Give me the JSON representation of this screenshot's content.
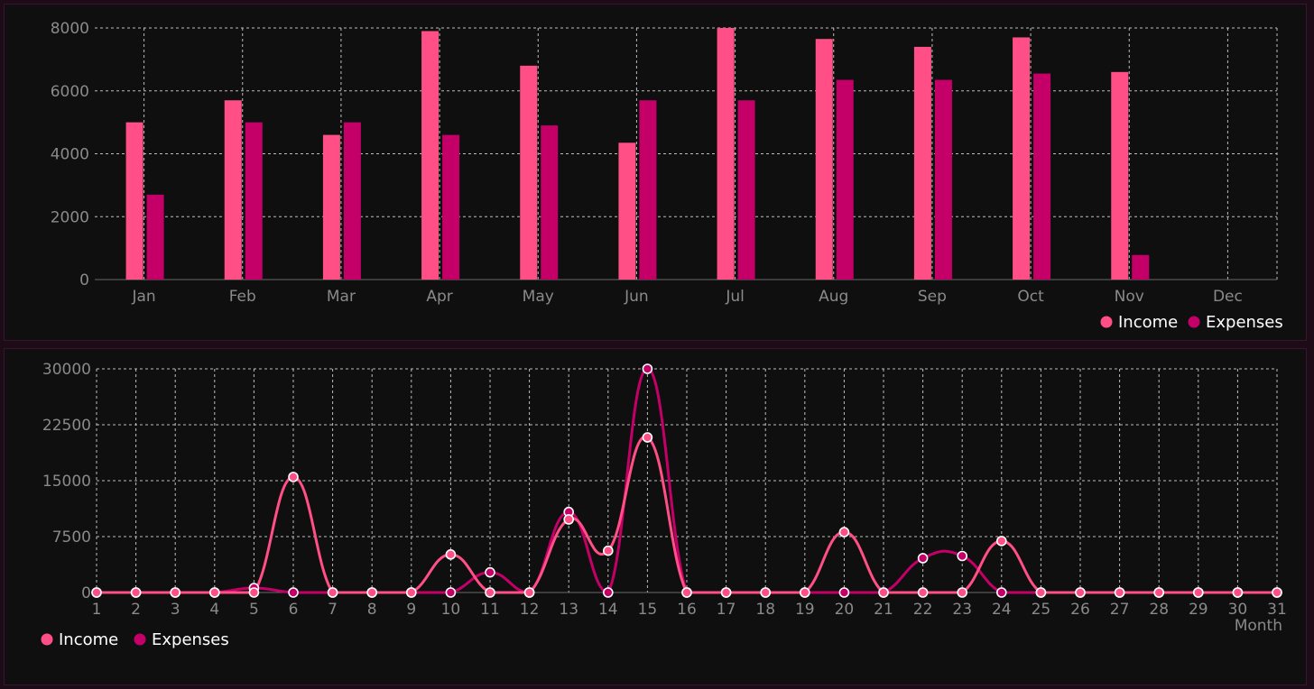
{
  "colors": {
    "income": "#ff4f86",
    "expenses": "#c40068",
    "background": "#0f0f0f",
    "grid": "#bdbdbd",
    "tick": "#8a8a8a"
  },
  "chart_data": [
    {
      "type": "bar",
      "categories": [
        "Jan",
        "Feb",
        "Mar",
        "Apr",
        "May",
        "Jun",
        "Jul",
        "Aug",
        "Sep",
        "Oct",
        "Nov",
        "Dec"
      ],
      "series": [
        {
          "name": "Income",
          "values": [
            5000,
            5700,
            4600,
            7900,
            6800,
            4350,
            8000,
            7650,
            7400,
            7700,
            6600,
            0
          ]
        },
        {
          "name": "Expenses",
          "values": [
            2700,
            5000,
            5000,
            4600,
            4900,
            5700,
            5700,
            6350,
            6350,
            6550,
            780,
            0
          ]
        }
      ],
      "yticks": [
        "0",
        "2000",
        "4000",
        "6000",
        "8000"
      ],
      "ylim": [
        0,
        8000
      ],
      "grid": true,
      "legend": "bottom-right"
    },
    {
      "type": "line",
      "x": [
        1,
        2,
        3,
        4,
        5,
        6,
        7,
        8,
        9,
        10,
        11,
        12,
        13,
        14,
        15,
        16,
        17,
        18,
        19,
        20,
        21,
        22,
        23,
        24,
        25,
        26,
        27,
        28,
        29,
        30,
        31
      ],
      "xticks": [
        "1",
        "2",
        "3",
        "4",
        "5",
        "6",
        "7",
        "8",
        "9",
        "10",
        "11",
        "12",
        "13",
        "14",
        "15",
        "16",
        "17",
        "18",
        "19",
        "20",
        "21",
        "22",
        "23",
        "24",
        "25",
        "26",
        "27",
        "28",
        "29",
        "30",
        "31"
      ],
      "series": [
        {
          "name": "Income",
          "values": [
            0,
            0,
            0,
            0,
            0,
            15500,
            0,
            0,
            0,
            5100,
            0,
            0,
            9800,
            5600,
            20800,
            0,
            0,
            0,
            0,
            8100,
            0,
            0,
            0,
            6900,
            0,
            0,
            0,
            0,
            0,
            0,
            0
          ]
        },
        {
          "name": "Expenses",
          "values": [
            0,
            0,
            0,
            0,
            600,
            0,
            0,
            0,
            0,
            0,
            2700,
            0,
            10800,
            0,
            30000,
            0,
            0,
            0,
            0,
            0,
            0,
            4600,
            4900,
            0,
            0,
            0,
            0,
            0,
            0,
            0,
            0
          ]
        }
      ],
      "yticks": [
        "0",
        "7500",
        "15000",
        "22500",
        "30000"
      ],
      "ylim": [
        0,
        30000
      ],
      "xlabel": "Month",
      "grid": true,
      "legend": "bottom-left"
    }
  ]
}
